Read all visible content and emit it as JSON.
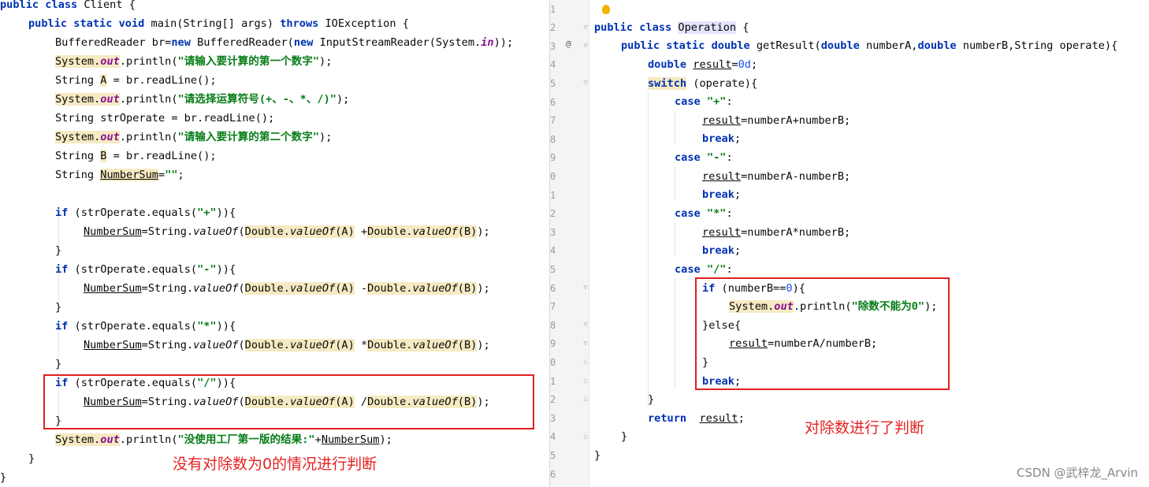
{
  "left_editor": {
    "lines": [
      [
        "public class Client {"
      ],
      [
        "BufferedReader br=new BufferedReader(new InputStreamReader(System.in));"
      ],
      [
        "System.out.println(\"请输入要计算的第一个数字\");"
      ],
      [
        "String A = br.readLine();"
      ],
      [
        "System.out.println(\"请选择运算符号(+、-、*、/)\");"
      ],
      [
        "String strOperate = br.readLine();"
      ],
      [
        "System.out.println(\"请输入要计算的第二个数字\");"
      ],
      [
        "String B = br.readLine();"
      ],
      [
        "String NumberSum=\"\";"
      ]
    ]
  },
  "right_editor": {
    "line_numbers": [
      "1",
      "2",
      "3",
      "4",
      "5",
      "6",
      "7",
      "8",
      "9",
      "0",
      "1",
      "2",
      "3",
      "4",
      "5",
      "6",
      "7",
      "8",
      "9",
      "0",
      "1",
      "2",
      "3",
      "4",
      "5",
      "6"
    ]
  },
  "annotations": {
    "left": "没有对除数为0的情况进行判断",
    "right": "对除数进行了判断"
  },
  "watermark": "CSDN @武梓龙_Arvin"
}
